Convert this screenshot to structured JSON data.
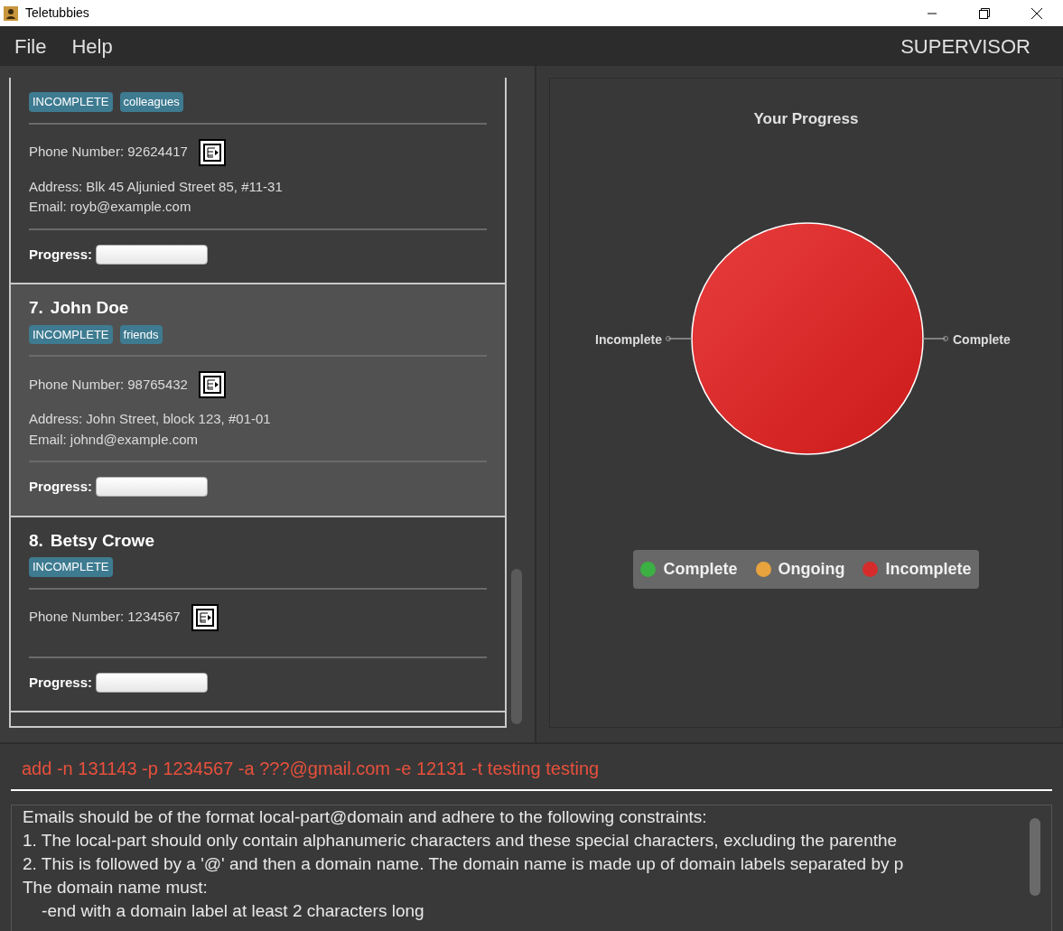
{
  "window": {
    "title": "Teletubbies"
  },
  "menu": [
    "File",
    "Help"
  ],
  "role": "SUPERVISOR",
  "persons": [
    {
      "selected": false,
      "tags": [
        "INCOMPLETE",
        "colleagues"
      ],
      "phone": "Phone Number: 92624417",
      "address": "Address: Blk 45 Aljunied Street 85, #11-31",
      "email": "Email: royb@example.com",
      "progress_label": "Progress:",
      "level": 0
    },
    {
      "number": "7.",
      "name": "John Doe",
      "selected": true,
      "tags": [
        "INCOMPLETE",
        "friends"
      ],
      "phone": "Phone Number: 98765432",
      "address": "Address: John Street, block 123, #01-01",
      "email": "Email: johnd@example.com",
      "progress_label": "Progress:",
      "level": 0
    },
    {
      "number": "8.",
      "name": "Betsy Crowe",
      "selected": false,
      "tags": [
        "INCOMPLETE"
      ],
      "phone": "Phone Number: 1234567",
      "progress_label": "Progress:",
      "level": 0
    }
  ],
  "chart": {
    "chart_data": {
      "type": "pie",
      "title": "Your Progress",
      "categories": [
        "Complete",
        "Incomplete"
      ],
      "values": [
        0,
        1
      ]
    },
    "legend": [
      {
        "label": "Complete",
        "color": "#3cb043"
      },
      {
        "label": "Ongoing",
        "color": "#e8a33e"
      },
      {
        "label": "Incomplete",
        "color": "#d62b2b"
      }
    ]
  },
  "command": "add -n 131143 -p 1234567 -a ???@gmail.com -e 12131 -t testing testing",
  "result": [
    "Emails should be of the format local-part@domain and adhere to the following constraints:",
    "1. The local-part should only contain alphanumeric characters and these special characters, excluding the parenthe",
    "2. This is followed by a '@' and then a domain name. The domain name is made up of domain labels separated by p",
    "The domain name must:",
    "    -end with a domain label at least 2 characters long"
  ]
}
